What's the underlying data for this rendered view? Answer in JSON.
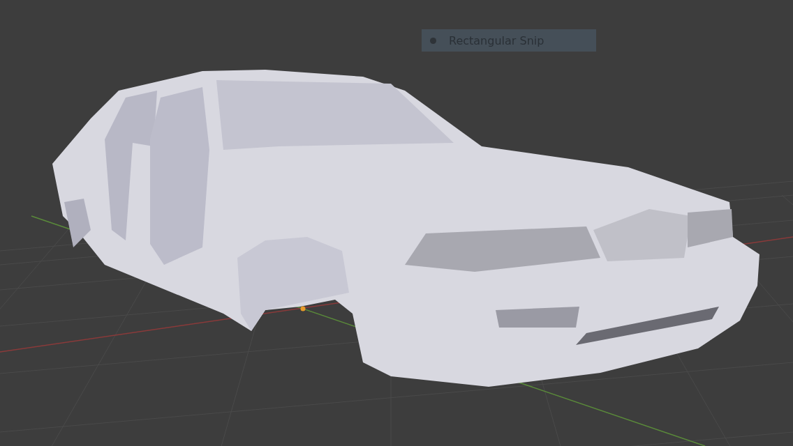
{
  "viewport": {
    "snip_tooltip": {
      "label": "Rectangular Snip"
    }
  }
}
